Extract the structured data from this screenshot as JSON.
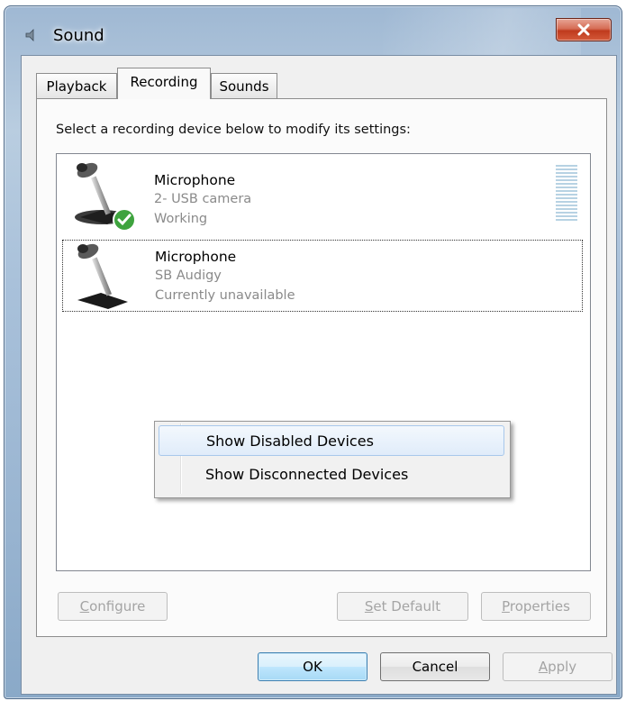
{
  "window": {
    "title": "Sound",
    "close_icon": "close-icon"
  },
  "tabs": [
    {
      "label": "Playback",
      "selected": false
    },
    {
      "label": "Recording",
      "selected": true
    },
    {
      "label": "Sounds",
      "selected": false
    }
  ],
  "recording": {
    "instruction": "Select a recording device below to modify its settings:",
    "devices": [
      {
        "name": "Microphone",
        "description": "2- USB camera",
        "status": "Working",
        "icon": "microphone-icon",
        "badge": "default-check-icon"
      },
      {
        "name": "Microphone",
        "description": "SB Audigy",
        "status": "Currently unavailable",
        "icon": "microphone-icon"
      }
    ]
  },
  "context_menu": {
    "items": [
      {
        "label": "Show Disabled Devices",
        "highlighted": true
      },
      {
        "label": "Show Disconnected Devices",
        "highlighted": false
      }
    ]
  },
  "buttons": {
    "configure": {
      "label": "Configure",
      "mnemonic": "C",
      "rest": "onfigure",
      "enabled": false
    },
    "set_default": {
      "label": "Set Default",
      "mnemonic": "S",
      "rest": "et Default",
      "enabled": false
    },
    "properties": {
      "label": "Properties",
      "mnemonic": "P",
      "rest": "roperties",
      "enabled": false
    },
    "ok": {
      "label": "OK",
      "enabled": true
    },
    "cancel": {
      "label": "Cancel",
      "enabled": true
    },
    "apply": {
      "label": "Apply",
      "mnemonic": "A",
      "rest": "pply",
      "enabled": false
    }
  },
  "colors": {
    "accent": "#3c7fb1",
    "disabled_text": "#a4a4a4",
    "secondary_text": "#8a8a8a",
    "highlight": "#a8c8eb",
    "close_button": "#c84a2c"
  }
}
